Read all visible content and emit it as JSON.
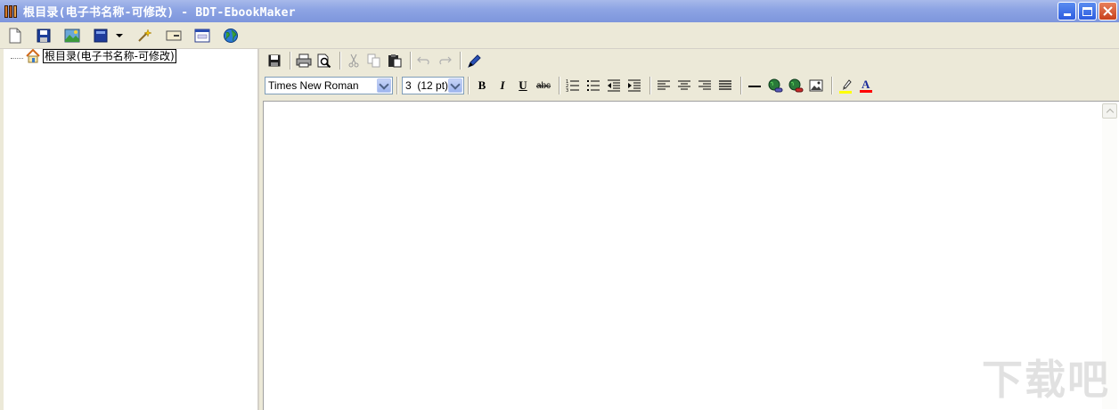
{
  "window": {
    "title": "根目录(电子书名称-可修改) - BDT-EbookMaker",
    "controls": [
      "minimize",
      "maximize",
      "close"
    ]
  },
  "main_toolbar": {
    "buttons": [
      "new-icon",
      "save-icon",
      "image-icon",
      "book-icon",
      "wand-icon",
      "card-icon",
      "window-icon",
      "globe-icon"
    ]
  },
  "tree": {
    "root_label": "根目录(电子书名称-可修改)"
  },
  "editor": {
    "font_name": "Times New Roman",
    "font_size": "3  (12 pt)",
    "format_labels": {
      "bold": "B",
      "italic": "I",
      "underline": "U",
      "strike": "abc",
      "font_color": "A"
    }
  },
  "watermark": "下载吧",
  "colors": {
    "titlebar": "#8ea5e4",
    "chrome": "#ece9d8",
    "highlight": "#ffff00",
    "font_color_bar": "#ff0000"
  }
}
